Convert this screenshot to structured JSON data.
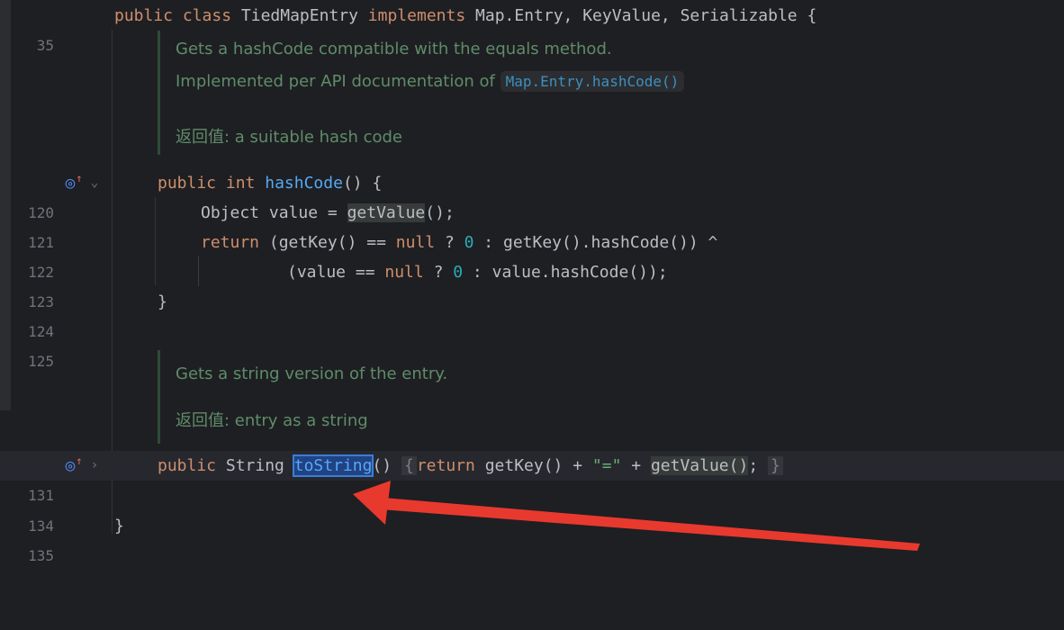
{
  "gutter": {
    "line_35": "35",
    "line_120": "120",
    "line_121": "121",
    "line_122": "122",
    "line_123": "123",
    "line_124": "124",
    "line_125": "125",
    "line_131": "131",
    "line_134": "134",
    "line_135": "135",
    "implements_icon": "overriding-method-icon",
    "fold_icon_expanded": "chevron-down-icon",
    "fold_icon_collapsed": "chevron-right-icon"
  },
  "code": {
    "l35": {
      "kw_public": "public",
      "kw_class": "class",
      "name": "TiedMapEntry",
      "kw_implements": "implements",
      "rest": "Map.Entry, KeyValue, Serializable {"
    },
    "doc1": {
      "line1": "Gets a hashCode compatible with the equals method.",
      "line2_prefix": "Implemented per API documentation of ",
      "line2_link": "Map.Entry.hashCode()",
      "returns_label": "返回值: ",
      "returns_text": "a suitable hash code"
    },
    "l120": {
      "kw_public": "public",
      "kw_int": "int",
      "fn": "hashCode",
      "rest": "() {"
    },
    "l121": {
      "start": "Object value = ",
      "call": "getValue",
      "end": "();"
    },
    "l122": {
      "kw_return": "return",
      "p1": " (getKey() == ",
      "kw_null": "null",
      "p2": " ? ",
      "zero": "0",
      "p3": " : getKey().hashCode()) ^"
    },
    "l123": {
      "p1": "(value == ",
      "kw_null": "null",
      "p2": " ? ",
      "zero": "0",
      "p3": " : value.hashCode());"
    },
    "l124": {
      "brace": "}"
    },
    "doc2": {
      "line1": "Gets a string version of the entry.",
      "returns_label": "返回值: ",
      "returns_text": "entry as a string"
    },
    "l131": {
      "kw_public": "public",
      "type": "String",
      "fn": "toString",
      "parens": "()",
      "fold_open": "{",
      "kw_return": "return",
      "p1": " getKey() + ",
      "str": "\"=\"",
      "p2": " + ",
      "call": "getValue",
      "call_end": "()",
      "semi": ";",
      "fold_close": "}"
    },
    "l135": {
      "brace": "}"
    }
  },
  "colors": {
    "background": "#1e1f22",
    "keyword": "#cf8e6d",
    "function": "#56a8f5",
    "number": "#2aacb8",
    "string": "#6aab73",
    "doc_text": "#5f8c6a",
    "annotation_arrow": "#e8392f"
  }
}
